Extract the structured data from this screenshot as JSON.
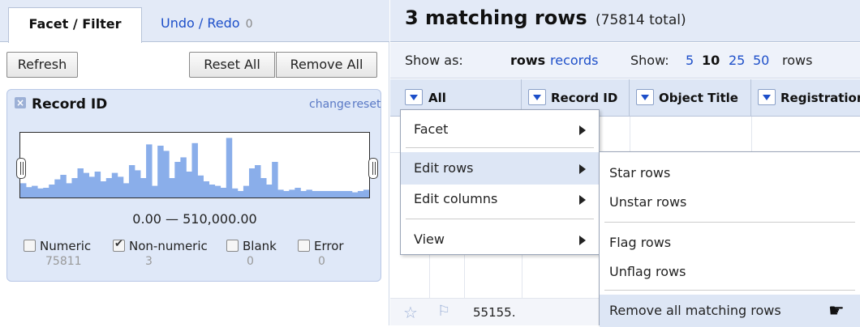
{
  "left_panel": {
    "tabs": {
      "facet_filter": "Facet / Filter",
      "undo_redo": "Undo / Redo",
      "undo_count": "0"
    },
    "buttons": {
      "refresh": "Refresh",
      "reset_all": "Reset All",
      "remove_all": "Remove All"
    },
    "facet": {
      "title": "Record ID",
      "change": "change",
      "reset": "reset",
      "range": "0.00 — 510,000.00",
      "choices": [
        {
          "label": "Numeric",
          "count": "75811",
          "checked": false
        },
        {
          "label": "Non-numeric",
          "count": "3",
          "checked": true
        },
        {
          "label": "Blank",
          "count": "0",
          "checked": false
        },
        {
          "label": "Error",
          "count": "0",
          "checked": false
        }
      ],
      "histogram_bins": [
        0.22,
        0.16,
        0.18,
        0.14,
        0.15,
        0.2,
        0.28,
        0.35,
        0.22,
        0.3,
        0.45,
        0.38,
        0.32,
        0.4,
        0.25,
        0.3,
        0.38,
        0.32,
        0.22,
        0.5,
        0.42,
        0.3,
        0.82,
        0.18,
        0.8,
        0.72,
        0.3,
        0.55,
        0.62,
        0.4,
        0.84,
        0.34,
        0.25,
        0.2,
        0.18,
        0.15,
        0.92,
        0.14,
        0.1,
        0.18,
        0.45,
        0.5,
        0.3,
        0.2,
        0.55,
        0.12,
        0.1,
        0.12,
        0.15,
        0.1,
        0.12,
        0.1,
        0.1,
        0.1,
        0.1,
        0.1,
        0.1,
        0.1,
        0.08,
        0.1,
        0.12
      ]
    }
  },
  "right_panel": {
    "summary": {
      "matching": "3 matching rows",
      "total": "(75814 total)"
    },
    "viewbar": {
      "show_as": "Show as:",
      "mode_rows": "rows",
      "mode_records": "records",
      "show": "Show:",
      "page_sizes": [
        "5",
        "10",
        "25",
        "50"
      ],
      "rows_suffix": "rows"
    },
    "columns": [
      "All",
      "Record ID",
      "Object Title",
      "Registration"
    ],
    "row_value": "55155."
  },
  "menus": {
    "main": [
      "Facet",
      "Edit rows",
      "Edit columns",
      "View"
    ],
    "edit_rows_sub": [
      "Star rows",
      "Unstar rows",
      "Flag rows",
      "Unflag rows",
      "Remove all matching rows"
    ]
  },
  "colors": {
    "accent": "#1d4fc9",
    "histogram": "#8aaeea",
    "panel": "#dfe8f8"
  }
}
